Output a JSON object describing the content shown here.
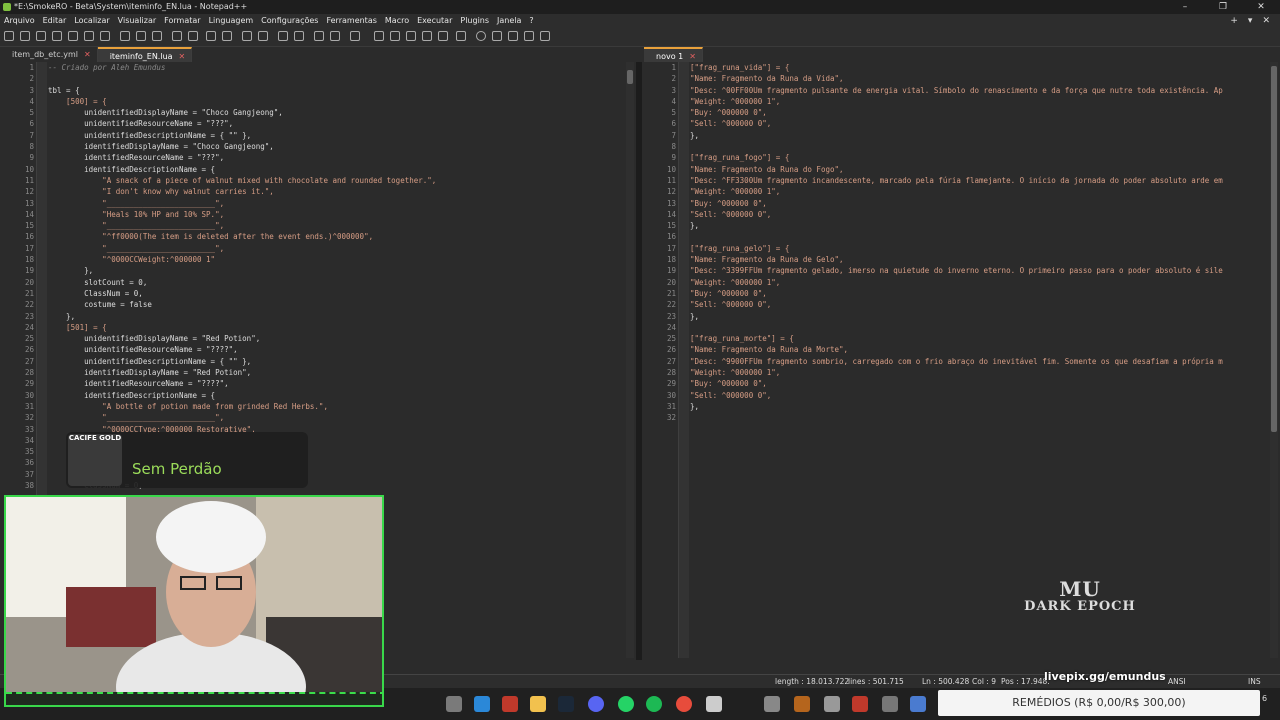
{
  "window": {
    "title": "*E:\\SmokeRO - Beta\\System\\iteminfo_EN.lua - Notepad++",
    "min": "–",
    "max": "❐",
    "close": "✕"
  },
  "menu": [
    "Arquivo",
    "Editar",
    "Localizar",
    "Visualizar",
    "Formatar",
    "Linguagem",
    "Configurações",
    "Ferramentas",
    "Macro",
    "Executar",
    "Plugins",
    "Janela",
    "?"
  ],
  "menu_right": [
    "+",
    "▾",
    "✕"
  ],
  "left_tabs": [
    {
      "label": "item_db_etc.yml",
      "close": "✕"
    },
    {
      "label": "iteminfo_EN.lua",
      "close": "✕"
    }
  ],
  "right_tabs": [
    {
      "label": "novo 1",
      "close": "✕"
    }
  ],
  "left_line_numbers": [
    "1",
    "2",
    "3",
    "4",
    "5",
    "6",
    "7",
    "8",
    "9",
    "10",
    "11",
    "12",
    "13",
    "14",
    "15",
    "16",
    "17",
    "18",
    "19",
    "20",
    "21",
    "22",
    "23",
    "24",
    "25",
    "26",
    "27",
    "28",
    "29",
    "30",
    "31",
    "32",
    "33",
    "34",
    "35",
    "36",
    "37",
    "38"
  ],
  "left_code": [
    "-- Criado por Aleh Emundus",
    "",
    "tbl = {",
    "    [500] = {",
    "        unidentifiedDisplayName = \"Choco Gangjeong\",",
    "        unidentifiedResourceName = \"???\",",
    "        unidentifiedDescriptionName = { \"\" },",
    "        identifiedDisplayName = \"Choco Gangjeong\",",
    "        identifiedResourceName = \"???\",",
    "        identifiedDescriptionName = {",
    "            \"A snack of a piece of walnut mixed with chocolate and rounded together.\",",
    "            \"I don't know why walnut carries it.\",",
    "            \"________________________\",",
    "            \"Heals 10% HP and 10% SP.\",",
    "            \"________________________\",",
    "            \"^ff0000(The item is deleted after the event ends.)^000000\",",
    "            \"________________________\",",
    "            \"^0000CCWeight:^000000 1\"",
    "        },",
    "        slotCount = 0,",
    "        ClassNum = 0,",
    "        costume = false",
    "    },",
    "    [501] = {",
    "        unidentifiedDisplayName = \"Red Potion\",",
    "        unidentifiedResourceName = \"????\",",
    "        unidentifiedDescriptionName = { \"\" },",
    "        identifiedDisplayName = \"Red Potion\",",
    "        identifiedResourceName = \"????\",",
    "        identifiedDescriptionName = {",
    "            \"A bottle of potion made from grinded Red Herbs.\",",
    "            \"________________________\",",
    "            \"^0000CCType:^000000 Restorative\",",
    "",
    "",
    "",
    "",
    "        ClassNum = 0,"
  ],
  "right_line_numbers": [
    "1",
    "2",
    "3",
    "4",
    "5",
    "6",
    "7",
    "8",
    "9",
    "10",
    "11",
    "12",
    "13",
    "14",
    "15",
    "16",
    "17",
    "18",
    "19",
    "20",
    "21",
    "22",
    "23",
    "24",
    "25",
    "26",
    "27",
    "28",
    "29",
    "30",
    "31",
    "32"
  ],
  "right_code": [
    "[\"frag_runa_vida\"] = {",
    "\"Name: Fragmento da Runa da Vida\",",
    "\"Desc: ^00FF00Um fragmento pulsante de energia vital. Símbolo do renascimento e da força que nutre toda existência. Ap",
    "\"Weight: ^000000 1\",",
    "\"Buy: ^000000 0\",",
    "\"Sell: ^000000 0\",",
    "},",
    "",
    "[\"frag_runa_fogo\"] = {",
    "\"Name: Fragmento da Runa do Fogo\",",
    "\"Desc: ^FF3300Um fragmento incandescente, marcado pela fúria flamejante. O início da jornada do poder absoluto arde em",
    "\"Weight: ^000000 1\",",
    "\"Buy: ^000000 0\",",
    "\"Sell: ^000000 0\",",
    "},",
    "",
    "[\"frag_runa_gelo\"] = {",
    "\"Name: Fragmento da Runa de Gelo\",",
    "\"Desc: ^3399FFUm fragmento gelado, imerso na quietude do inverno eterno. O primeiro passo para o poder absoluto é sile",
    "\"Weight: ^000000 1\",",
    "\"Buy: ^000000 0\",",
    "\"Sell: ^000000 0\",",
    "},",
    "",
    "[\"frag_runa_morte\"] = {",
    "\"Name: Fragmento da Runa da Morte\",",
    "\"Desc: ^9900FFUm fragmento sombrio, carregado com o frio abraço do inevitável fim. Somente os que desafiam a própria m",
    "\"Weight: ^000000 1\",",
    "\"Buy: ^000000 0\",",
    "\"Sell: ^000000 0\",",
    "},",
    ""
  ],
  "status": {
    "length": "length : 18.013.722",
    "lines": "lines : 501.715",
    "ln": "Ln : 500.428",
    "col": "Col : 9",
    "pos": "Pos : 17.948.",
    "encoding": "ANSI",
    "mode": "INS"
  },
  "overlay": {
    "logo_text": "CACIFE GOLD",
    "label": "Sem Perdão",
    "livepix": "livepix.gg/emundus",
    "donation": "REMÉDIOS (R$ 0,00/R$ 300,00)",
    "mu_line1": "MU",
    "mu_line2": "DARK EPOCH",
    "right_edge_digit": "6"
  },
  "colors": {
    "accent_tab": "#e9a13b",
    "cam_border": "#39d84a",
    "overlay_text": "#9bdc5a"
  }
}
